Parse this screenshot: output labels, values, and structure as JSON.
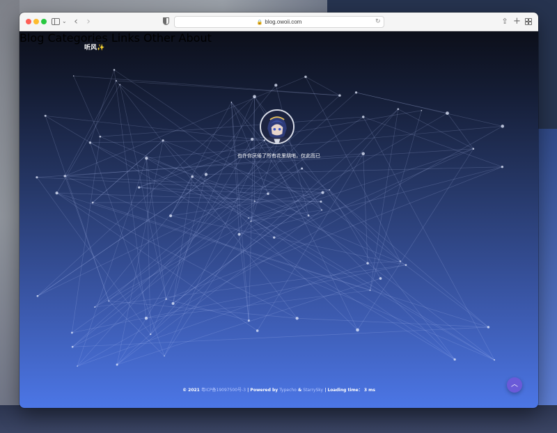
{
  "browser": {
    "url": "blog.owoii.com"
  },
  "site": {
    "brand": "听风✨",
    "nav": [
      "Blog",
      "Categories",
      "Links",
      "Other",
      "About"
    ],
    "tagline": "也许你厌倦了所有花里胡哨，仅此而已",
    "footer": {
      "copyright": "© 2021",
      "icp": "粤ICP备19097500号-3",
      "powered_prefix": "| Powered by",
      "engine": "Typecho",
      "amp": "&",
      "theme": "StarrySky",
      "loading_prefix": "| Loading time：",
      "loading_value": "3 ms"
    }
  },
  "icons": {
    "back": "chevron-left-icon",
    "forward": "chevron-right-icon",
    "lock": "lock-icon",
    "reload": "reload-icon",
    "share": "share-icon",
    "new_tab": "plus-icon",
    "tabs": "tabs-overview-icon",
    "to_top": "chevron-up-icon"
  },
  "colors": {
    "accent": "#6a5ad8",
    "gradient_top": "#0c0f1a",
    "gradient_bottom": "#4c76e6"
  }
}
